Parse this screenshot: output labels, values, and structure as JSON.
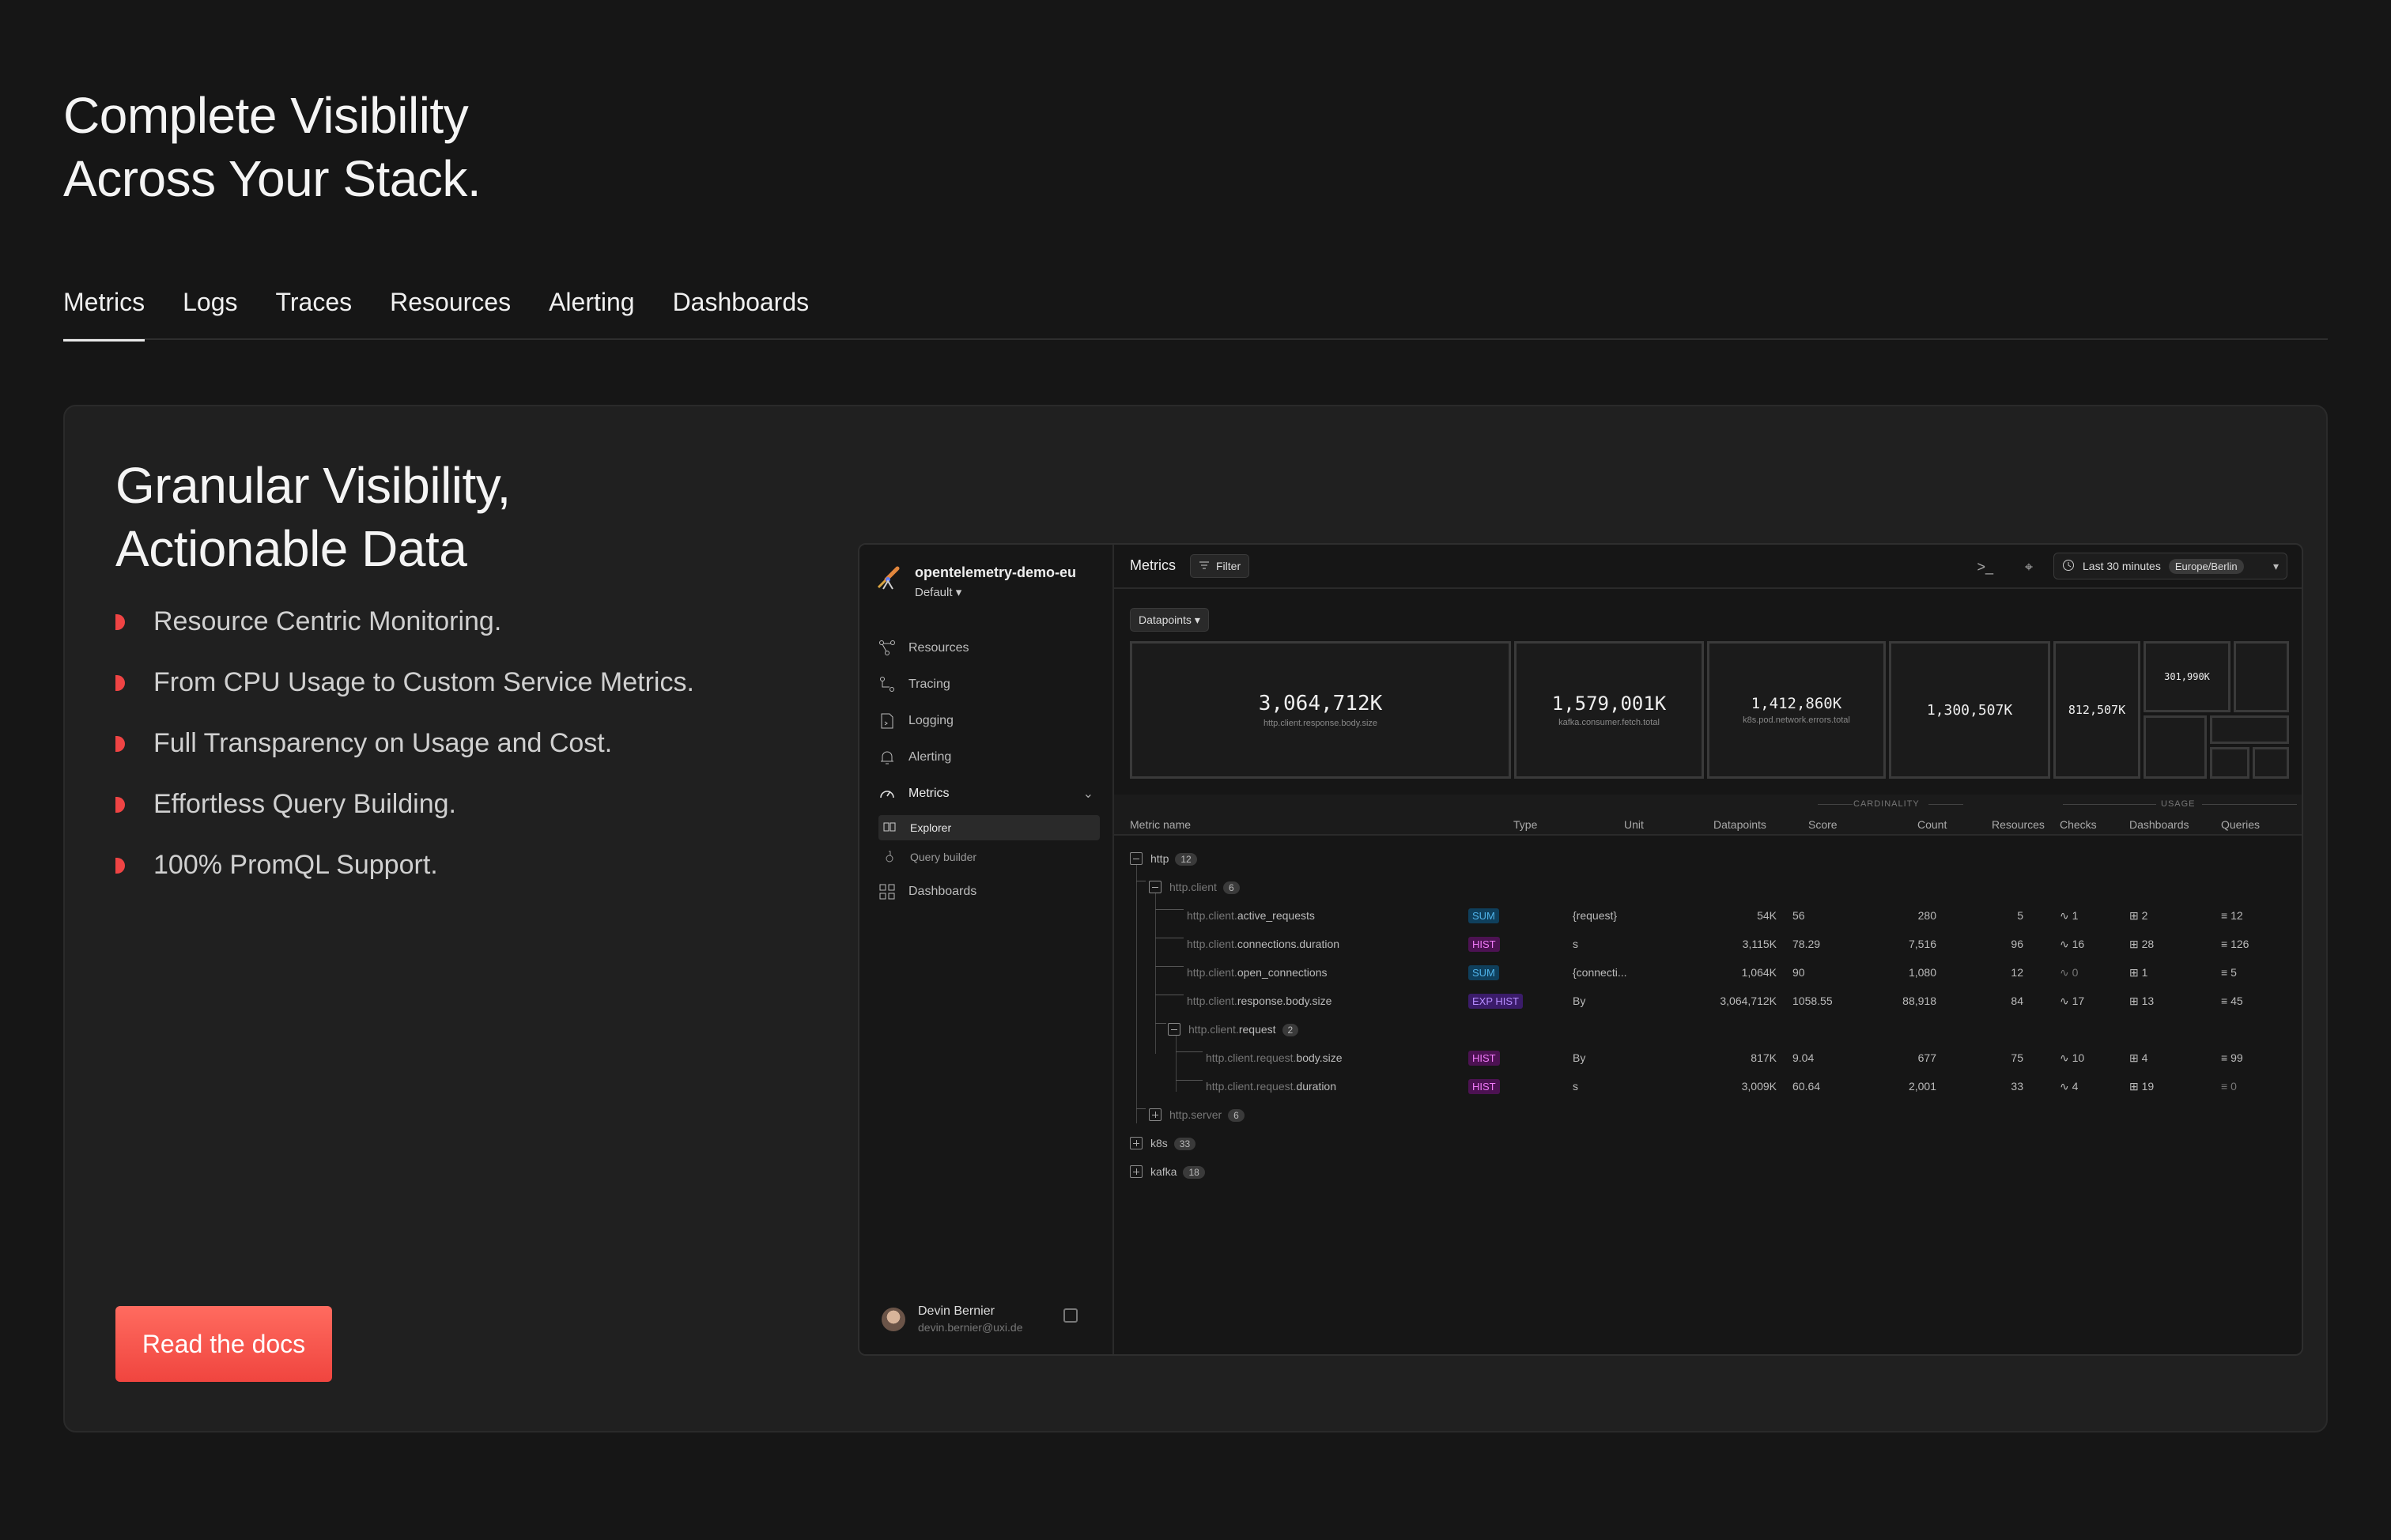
{
  "hero": {
    "line1": "Complete Visibility",
    "line2": "Across Your Stack."
  },
  "tabs": [
    "Metrics",
    "Logs",
    "Traces",
    "Resources",
    "Alerting",
    "Dashboards"
  ],
  "card": {
    "title_line1": "Granular Visibility,",
    "title_line2": "Actionable Data",
    "features": [
      "Resource Centric Monitoring.",
      "From CPU Usage to Custom Service Metrics.",
      "Full Transparency on Usage and Cost.",
      "Effortless Query Building.",
      "100% PromQL Support."
    ],
    "cta": "Read the docs"
  },
  "app": {
    "org_name": "opentelemetry-demo-eu",
    "org_env": "Default ▾",
    "nav": [
      "Resources",
      "Tracing",
      "Logging",
      "Alerting",
      "Metrics"
    ],
    "subnav": [
      "Explorer",
      "Query builder"
    ],
    "nav_last": "Dashboards",
    "user": {
      "name": "Devin Bernier",
      "email": "devin.bernier@uxi.de"
    },
    "topbar": {
      "page": "Metrics",
      "filter": "Filter",
      "time": "Last 30 minutes",
      "timezone": "Europe/Berlin"
    },
    "datapoints_btn": "Datapoints ▾",
    "treemap": [
      {
        "value": "3,064,712K",
        "label": "http.client.response.body.size"
      },
      {
        "value": "1,579,001K",
        "label": "kafka.consumer.fetch.total"
      },
      {
        "value": "1,412,860K",
        "label": "k8s.pod.network.errors.total"
      },
      {
        "value": "1,300,507K",
        "label": ""
      },
      {
        "value": "812,507K",
        "label": ""
      },
      {
        "value": "301,990K",
        "label": ""
      }
    ],
    "columns": {
      "metric": "Metric name",
      "type": "Type",
      "unit": "Unit",
      "datapoints": "Datapoints",
      "cardinality": "CARDINALITY",
      "score": "Score",
      "count": "Count",
      "resources": "Resources",
      "usage": "USAGE",
      "checks": "Checks",
      "dashboards": "Dashboards",
      "queries": "Queries"
    },
    "tree": {
      "http": {
        "name": "http",
        "count": "12"
      },
      "http_client": {
        "name": "http.client",
        "count": "6"
      },
      "http_client_request": {
        "prefix": "http.client.",
        "name": "request",
        "count": "2"
      },
      "http_server": {
        "name": "http.server",
        "count": "6"
      },
      "k8s": {
        "name": "k8s",
        "count": "33"
      },
      "kafka": {
        "name": "kafka",
        "count": "18"
      }
    },
    "rows": [
      {
        "prefix": "http.client.",
        "name": "active_requests",
        "type": "SUM",
        "unit": "{request}",
        "datapoints": "54K",
        "score": "56",
        "count": "280",
        "resources": "5",
        "checks": "1",
        "dashboards": "2",
        "queries": "12"
      },
      {
        "prefix": "http.client.",
        "name": "connections.duration",
        "type": "HIST",
        "unit": "s",
        "datapoints": "3,115K",
        "score": "78.29",
        "count": "7,516",
        "resources": "96",
        "checks": "16",
        "dashboards": "28",
        "queries": "126"
      },
      {
        "prefix": "http.client.",
        "name": "open_connections",
        "type": "SUM",
        "unit": "{connecti...",
        "datapoints": "1,064K",
        "score": "90",
        "count": "1,080",
        "resources": "12",
        "checks": "0",
        "dashboards": "1",
        "queries": "5"
      },
      {
        "prefix": "http.client.",
        "name": "response.body.size",
        "type": "EXP HIST",
        "unit": "By",
        "datapoints": "3,064,712K",
        "score": "1058.55",
        "count": "88,918",
        "resources": "84",
        "checks": "17",
        "dashboards": "13",
        "queries": "45"
      },
      {
        "prefix": "http.client.request.",
        "name": "body.size",
        "type": "HIST",
        "unit": "By",
        "datapoints": "817K",
        "score": "9.04",
        "count": "677",
        "resources": "75",
        "checks": "10",
        "dashboards": "4",
        "queries": "99"
      },
      {
        "prefix": "http.client.request.",
        "name": "duration",
        "type": "HIST",
        "unit": "s",
        "datapoints": "3,009K",
        "score": "60.64",
        "count": "2,001",
        "resources": "33",
        "checks": "4",
        "dashboards": "19",
        "queries": "0"
      }
    ]
  },
  "colors": {
    "accent": "#ef4444",
    "sum": "#4fb3ea",
    "hist": "#f07af8",
    "exp_hist": "#b68cff"
  }
}
